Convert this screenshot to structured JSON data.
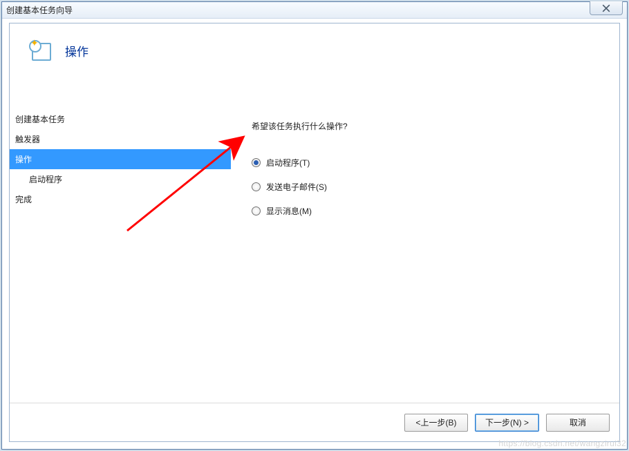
{
  "window": {
    "title": "创建基本任务向导"
  },
  "header": {
    "title": "操作"
  },
  "sidebar": {
    "items": [
      {
        "label": "创建基本任务",
        "selected": false,
        "sub": false
      },
      {
        "label": "触发器",
        "selected": false,
        "sub": false
      },
      {
        "label": "操作",
        "selected": true,
        "sub": false
      },
      {
        "label": "启动程序",
        "selected": false,
        "sub": true
      },
      {
        "label": "完成",
        "selected": false,
        "sub": false
      }
    ]
  },
  "main": {
    "question": "希望该任务执行什么操作?",
    "options": [
      {
        "label": "启动程序(T)",
        "checked": true
      },
      {
        "label": "发送电子邮件(S)",
        "checked": false
      },
      {
        "label": "显示消息(M)",
        "checked": false
      }
    ]
  },
  "footer": {
    "back": "<上一步(B)",
    "next": "下一步(N) >",
    "cancel": "取消"
  },
  "watermark": "https://blog.csdn.net/wangzirui32"
}
